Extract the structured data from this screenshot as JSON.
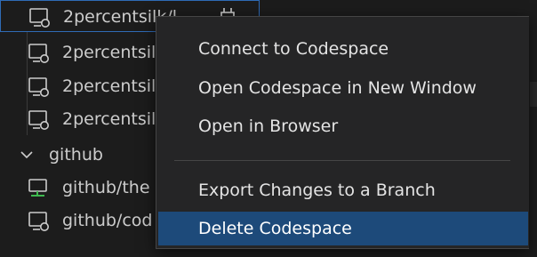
{
  "tree": {
    "items": [
      {
        "label": "2percentsilk/l...",
        "icon": "remote-desktop-icon"
      },
      {
        "label": "2percentsilk",
        "icon": "remote-desktop-icon"
      },
      {
        "label": "2percentsilk",
        "icon": "remote-desktop-icon"
      },
      {
        "label": "2percentsilk",
        "icon": "remote-desktop-icon"
      }
    ],
    "group": {
      "label": "github",
      "icon": "chevron-down-icon"
    },
    "group_items": [
      {
        "label": "github/the",
        "icon": "remote-desktop-active-icon"
      },
      {
        "label": "github/cod",
        "icon": "remote-desktop-icon"
      }
    ]
  },
  "context_menu": {
    "items": [
      {
        "label": "Connect to Codespace"
      },
      {
        "label": "Open Codespace in New Window"
      },
      {
        "label": "Open in Browser"
      },
      {
        "label": "Export Changes to a Branch"
      },
      {
        "label": "Delete Codespace",
        "active": true
      }
    ]
  },
  "colors": {
    "background": "#1c1c1c",
    "menu_background": "#252526",
    "menu_highlight": "#1d4a7a",
    "selection_border": "#2f6bb6",
    "active_icon": "#3fb950"
  }
}
